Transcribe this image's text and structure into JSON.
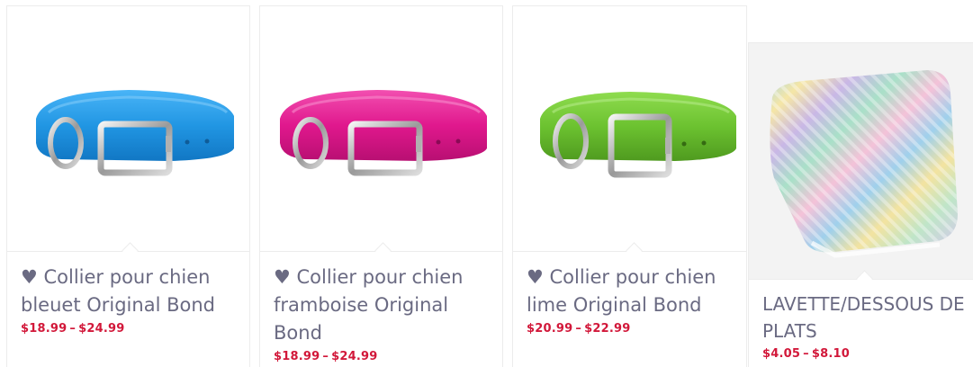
{
  "products": [
    {
      "title": "♥ Collier pour chien bleuet Original Bond",
      "price_min": "$18.99",
      "price_sep": "–",
      "price_max": "$24.99",
      "color": "#2196e3",
      "icon": "dog-collar-blue"
    },
    {
      "title": "♥ Collier pour chien framboise Original Bond",
      "price_min": "$18.99",
      "price_sep": "–",
      "price_max": "$24.99",
      "color": "#e0188d",
      "icon": "dog-collar-pink"
    },
    {
      "title": "♥ Collier pour chien lime Original Bond",
      "price_min": "$20.99",
      "price_sep": "–",
      "price_max": "$22.99",
      "color": "#6cc230",
      "icon": "dog-collar-green"
    },
    {
      "title": "LAVETTE/DESSOUS DE PLATS",
      "price_min": "$4.05",
      "price_sep": "–",
      "price_max": "$8.10",
      "icon": "knitted-dishcloth"
    }
  ],
  "colors": {
    "title_text": "#6a6a82",
    "price_text": "#d2183a",
    "card_border": "#ececec"
  }
}
